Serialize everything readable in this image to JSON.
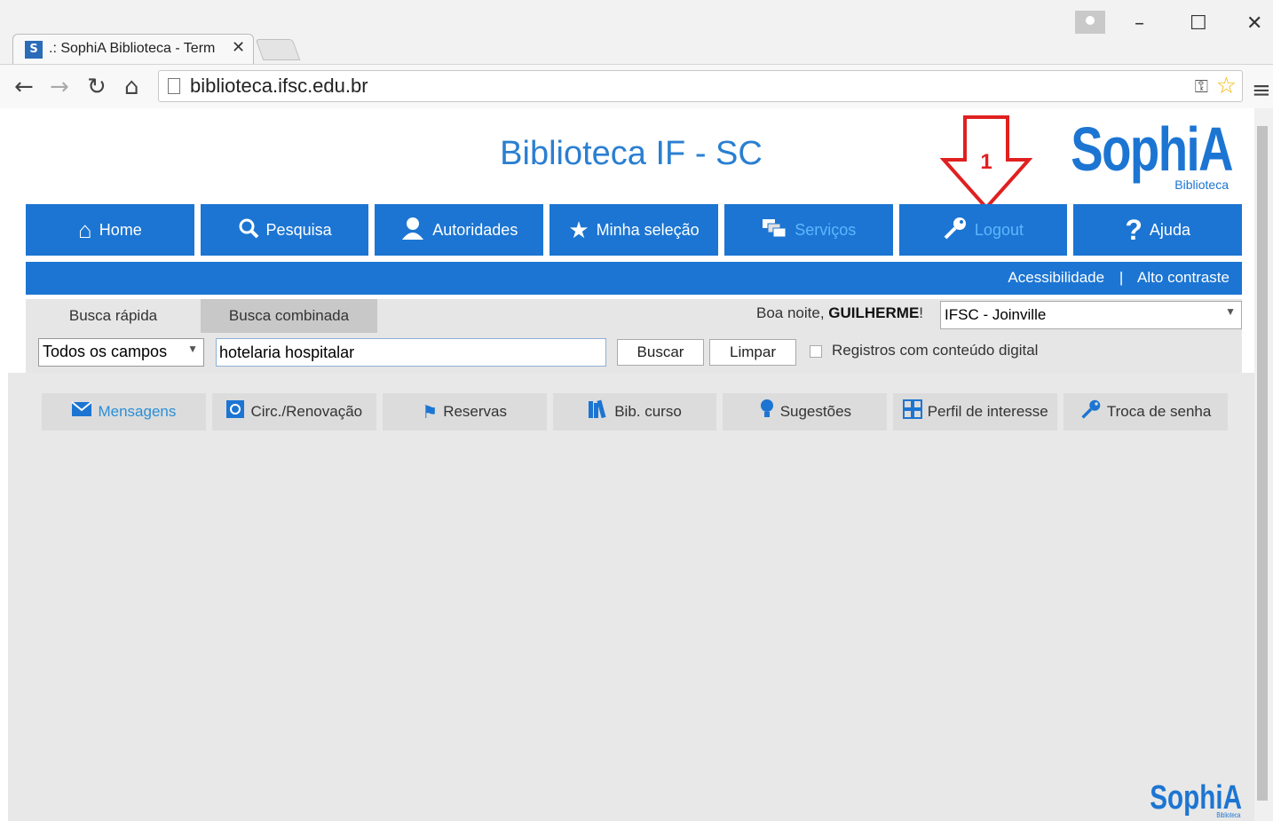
{
  "browser": {
    "tab_title": ".: SophiA Biblioteca - Term",
    "tab_favicon": "S",
    "tab_close": "✕",
    "url": "biblioteca.ifsc.edu.br",
    "window_buttons": [
      "–",
      "☐",
      "✕"
    ]
  },
  "header": {
    "title": "Biblioteca IF - SC",
    "logo_text": "SophiA",
    "logo_sub": "Biblioteca"
  },
  "annotation": {
    "label": "1",
    "color": "#e02020"
  },
  "nav": {
    "items": [
      {
        "label": "Home",
        "icon": "home-icon"
      },
      {
        "label": "Pesquisa",
        "icon": "search-icon"
      },
      {
        "label": "Autoridades",
        "icon": "person-icon"
      },
      {
        "label": "Minha seleção",
        "icon": "star-icon"
      },
      {
        "label": "Serviços",
        "icon": "services-icon"
      },
      {
        "label": "Logout",
        "icon": "key-icon"
      },
      {
        "label": "Ajuda",
        "icon": "help-icon"
      }
    ]
  },
  "subbar": {
    "accessibility": "Acessibilidade",
    "separator": "|",
    "contrast": "Alto contraste"
  },
  "search": {
    "tab_quick": "Busca rápida",
    "tab_combined": "Busca combinada",
    "greeting_prefix": "Boa noite, ",
    "user_name": "GUILHERME",
    "greeting_suffix": "!",
    "campus": "IFSC - Joinville",
    "field": "Todos os campos",
    "query": "hotelaria hospitalar",
    "btn_search": "Buscar",
    "btn_clear": "Limpar",
    "digital_label": "Registros com conteúdo digital"
  },
  "services": [
    {
      "label": "Mensagens",
      "icon": "mail-icon"
    },
    {
      "label": "Circ./Renovação",
      "icon": "circulation-icon"
    },
    {
      "label": "Reservas",
      "icon": "flag-icon"
    },
    {
      "label": "Bib. curso",
      "icon": "books-icon"
    },
    {
      "label": "Sugestões",
      "icon": "lightbulb-icon"
    },
    {
      "label": "Perfil de interesse",
      "icon": "grid-icon"
    },
    {
      "label": "Troca de senha",
      "icon": "key-icon"
    }
  ],
  "footer": {
    "logo_text": "SophiA",
    "logo_sub": "Biblioteca"
  },
  "colors": {
    "brand": "#1c75d2",
    "highlight_text": "#5fb6ff",
    "annotation": "#e02020"
  }
}
